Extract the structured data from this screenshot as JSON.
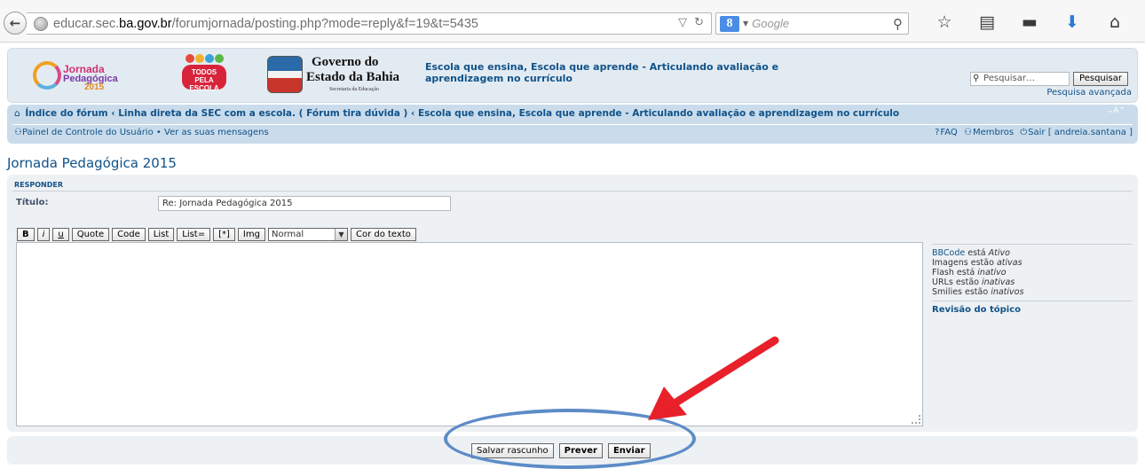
{
  "browser": {
    "url_pre": "educar.sec.",
    "url_domain": "ba.gov.br",
    "url_post": "/forumjornada/posting.php?mode=reply&f=19&t=5435",
    "search_engine_letter": "8",
    "search_engine_name": "Google",
    "reload_icon": "↻",
    "dropdown_icon": "▽"
  },
  "header": {
    "logo1_line1": "Jornada",
    "logo1_line2": "Pedagógica",
    "logo1_line3": "2015",
    "logo2_line1": "TODOS",
    "logo2_line2": "PELA",
    "logo2_line3": "ESCOLA",
    "logo3_line1": "Governo do",
    "logo3_line2": "Estado da Bahia",
    "logo3_line3": "Secretaria da Educação",
    "site_description": "Escola que ensina, Escola que aprende - Articulando avaliação e aprendizagem no currículo",
    "search_placeholder": "Pesquisar…",
    "search_button": "Pesquisar",
    "advanced_search": "Pesquisa avançada"
  },
  "navbar": {
    "breadcrumb": "Índice do fórum ‹ Linha direta da SEC com a escola. ( Fórum tira dúvida ) ‹ Escola que ensina, Escola que aprende - Articulando avaliação e aprendizagem no currículo",
    "ucp": "Painel de Controle do Usuário",
    "separator": "•",
    "messages": "Ver as suas mensagens",
    "faq": "FAQ",
    "members": "Membros",
    "logout": "Sair [ andreia.santana ]"
  },
  "page": {
    "title": "Jornada Pedagógica 2015"
  },
  "form": {
    "section": "RESPONDER",
    "title_label": "Título:",
    "title_value": "Re: Jornada Pedagógica 2015",
    "bbcode_buttons": {
      "bold": "B",
      "italic": "i",
      "underline": "u",
      "quote": "Quote",
      "code": "Code",
      "list": "List",
      "list_eq": "List=",
      "list_item": "[*]",
      "img": "Img",
      "font_size": "Normal",
      "color": "Cor do texto"
    },
    "side_info": {
      "bbcode_link": "BBCode",
      "bbcode_text": "está",
      "bbcode_state": "Ativo",
      "images_text": "Imagens estão",
      "images_state": "ativas",
      "flash_text": "Flash está",
      "flash_state": "inativo",
      "urls_text": "URLs estão",
      "urls_state": "inativas",
      "smilies_text": "Smilies estão",
      "smilies_state": "inativos",
      "topic_review": "Revisão do tópico"
    }
  },
  "submit": {
    "save_draft": "Salvar rascunho",
    "preview": "Prever",
    "send": "Enviar"
  },
  "colors": {
    "link_blue": "#105289",
    "nav_bg": "#cadceb",
    "panel_bg": "#eef1f3",
    "annotation_arrow": "#e8202a",
    "annotation_ellipse": "#5d8cc7"
  }
}
